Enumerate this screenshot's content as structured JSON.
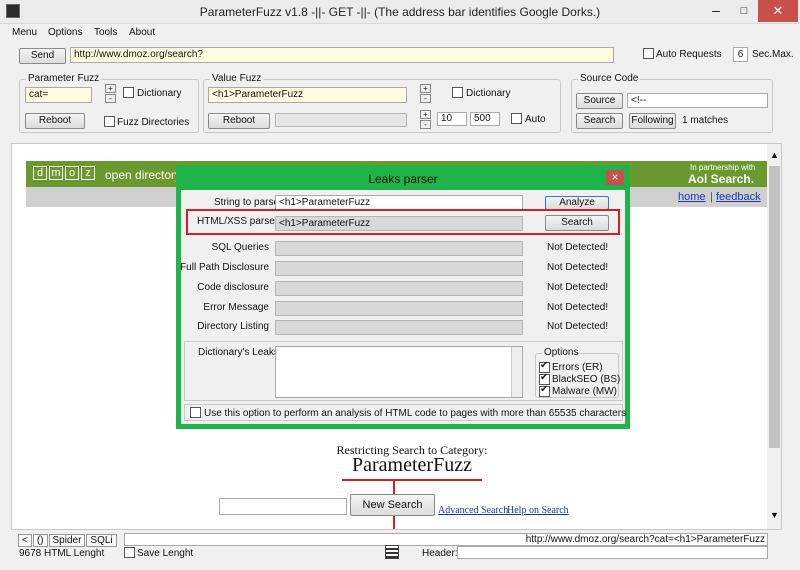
{
  "window": {
    "title": "ParameterFuzz v1.8   -||-   GET   -||-   (The address bar identifies Google Dorks.)"
  },
  "menu": [
    "Menu",
    "Options",
    "Tools",
    "About"
  ],
  "toolbar": {
    "send_label": "Send",
    "url": "http://www.dmoz.org/search?",
    "auto_requests_label": "Auto Requests",
    "sec_value": "6",
    "sec_label": "Sec.Max."
  },
  "parameter_fuzz": {
    "title": "Parameter Fuzz",
    "value": "cat=",
    "dictionary_label": "Dictionary",
    "reboot_label": "Reboot",
    "fuzz_dirs_label": "Fuzz Directories"
  },
  "value_fuzz": {
    "title": "Value Fuzz",
    "value": "<h1>ParameterFuzz",
    "dictionary_label": "Dictionary",
    "reboot_label": "Reboot",
    "range_from": "10",
    "range_to": "500",
    "auto_label": "Auto"
  },
  "source_code": {
    "title": "Source Code",
    "source_label": "Source",
    "source_value": "<!--",
    "search_label": "Search",
    "following_label": "Following",
    "matches": "1 matches"
  },
  "browser": {
    "dmoz_letters": [
      "d",
      "m",
      "o",
      "z"
    ],
    "open_directory": "open directory",
    "partner_small": "In partnership with",
    "partner_brand": "Aol Search.",
    "home_link": "home",
    "separator": "|",
    "feedback_link": "feedback",
    "restricting": "Restricting Search to Category:",
    "category": "ParameterFuzz",
    "new_search_label": "New Search",
    "advanced_search": "Advanced Search",
    "help_on_search": "Help on Search"
  },
  "dialog": {
    "title": "Leaks parser",
    "close": "×",
    "string_to_parse_label": "String to parse",
    "string_to_parse_value": "<h1>ParameterFuzz",
    "analyze_label": "Analyze",
    "html_xss_label": "HTML/XSS parser",
    "html_xss_value": "<h1>ParameterFuzz",
    "search_label": "Search",
    "rows": [
      {
        "label": "SQL Queries",
        "status": "Not Detected!"
      },
      {
        "label": "Full Path Disclosure",
        "status": "Not Detected!"
      },
      {
        "label": "Code disclosure",
        "status": "Not Detected!"
      },
      {
        "label": "Error Message",
        "status": "Not Detected!"
      },
      {
        "label": "Directory Listing",
        "status": "Not Detected!"
      }
    ],
    "dictionary_leaks_label": "Dictionary's Leaks",
    "options_title": "Options",
    "options": [
      {
        "label": "Errors (ER)",
        "checked": true
      },
      {
        "label": "BlackSEO (BS)",
        "checked": true
      },
      {
        "label": "Malware (MW)",
        "checked": true
      }
    ],
    "bottom_option": "Use this option to perform an analysis of HTML code to pages with more than 65535 characters"
  },
  "bottom_bar": {
    "tabs": [
      "<",
      "()",
      "Spider",
      "SQLi"
    ],
    "status_url": "http://www.dmoz.org/search?cat=<h1>ParameterFuzz",
    "html_length": "9678 HTML Lenght",
    "save_length_label": "Save Lenght",
    "header_label": "Header:"
  },
  "colors": {
    "dmoz_green": "#6a9a2f",
    "dialog_green": "#1fb44a",
    "highlight_red": "#d42020"
  }
}
